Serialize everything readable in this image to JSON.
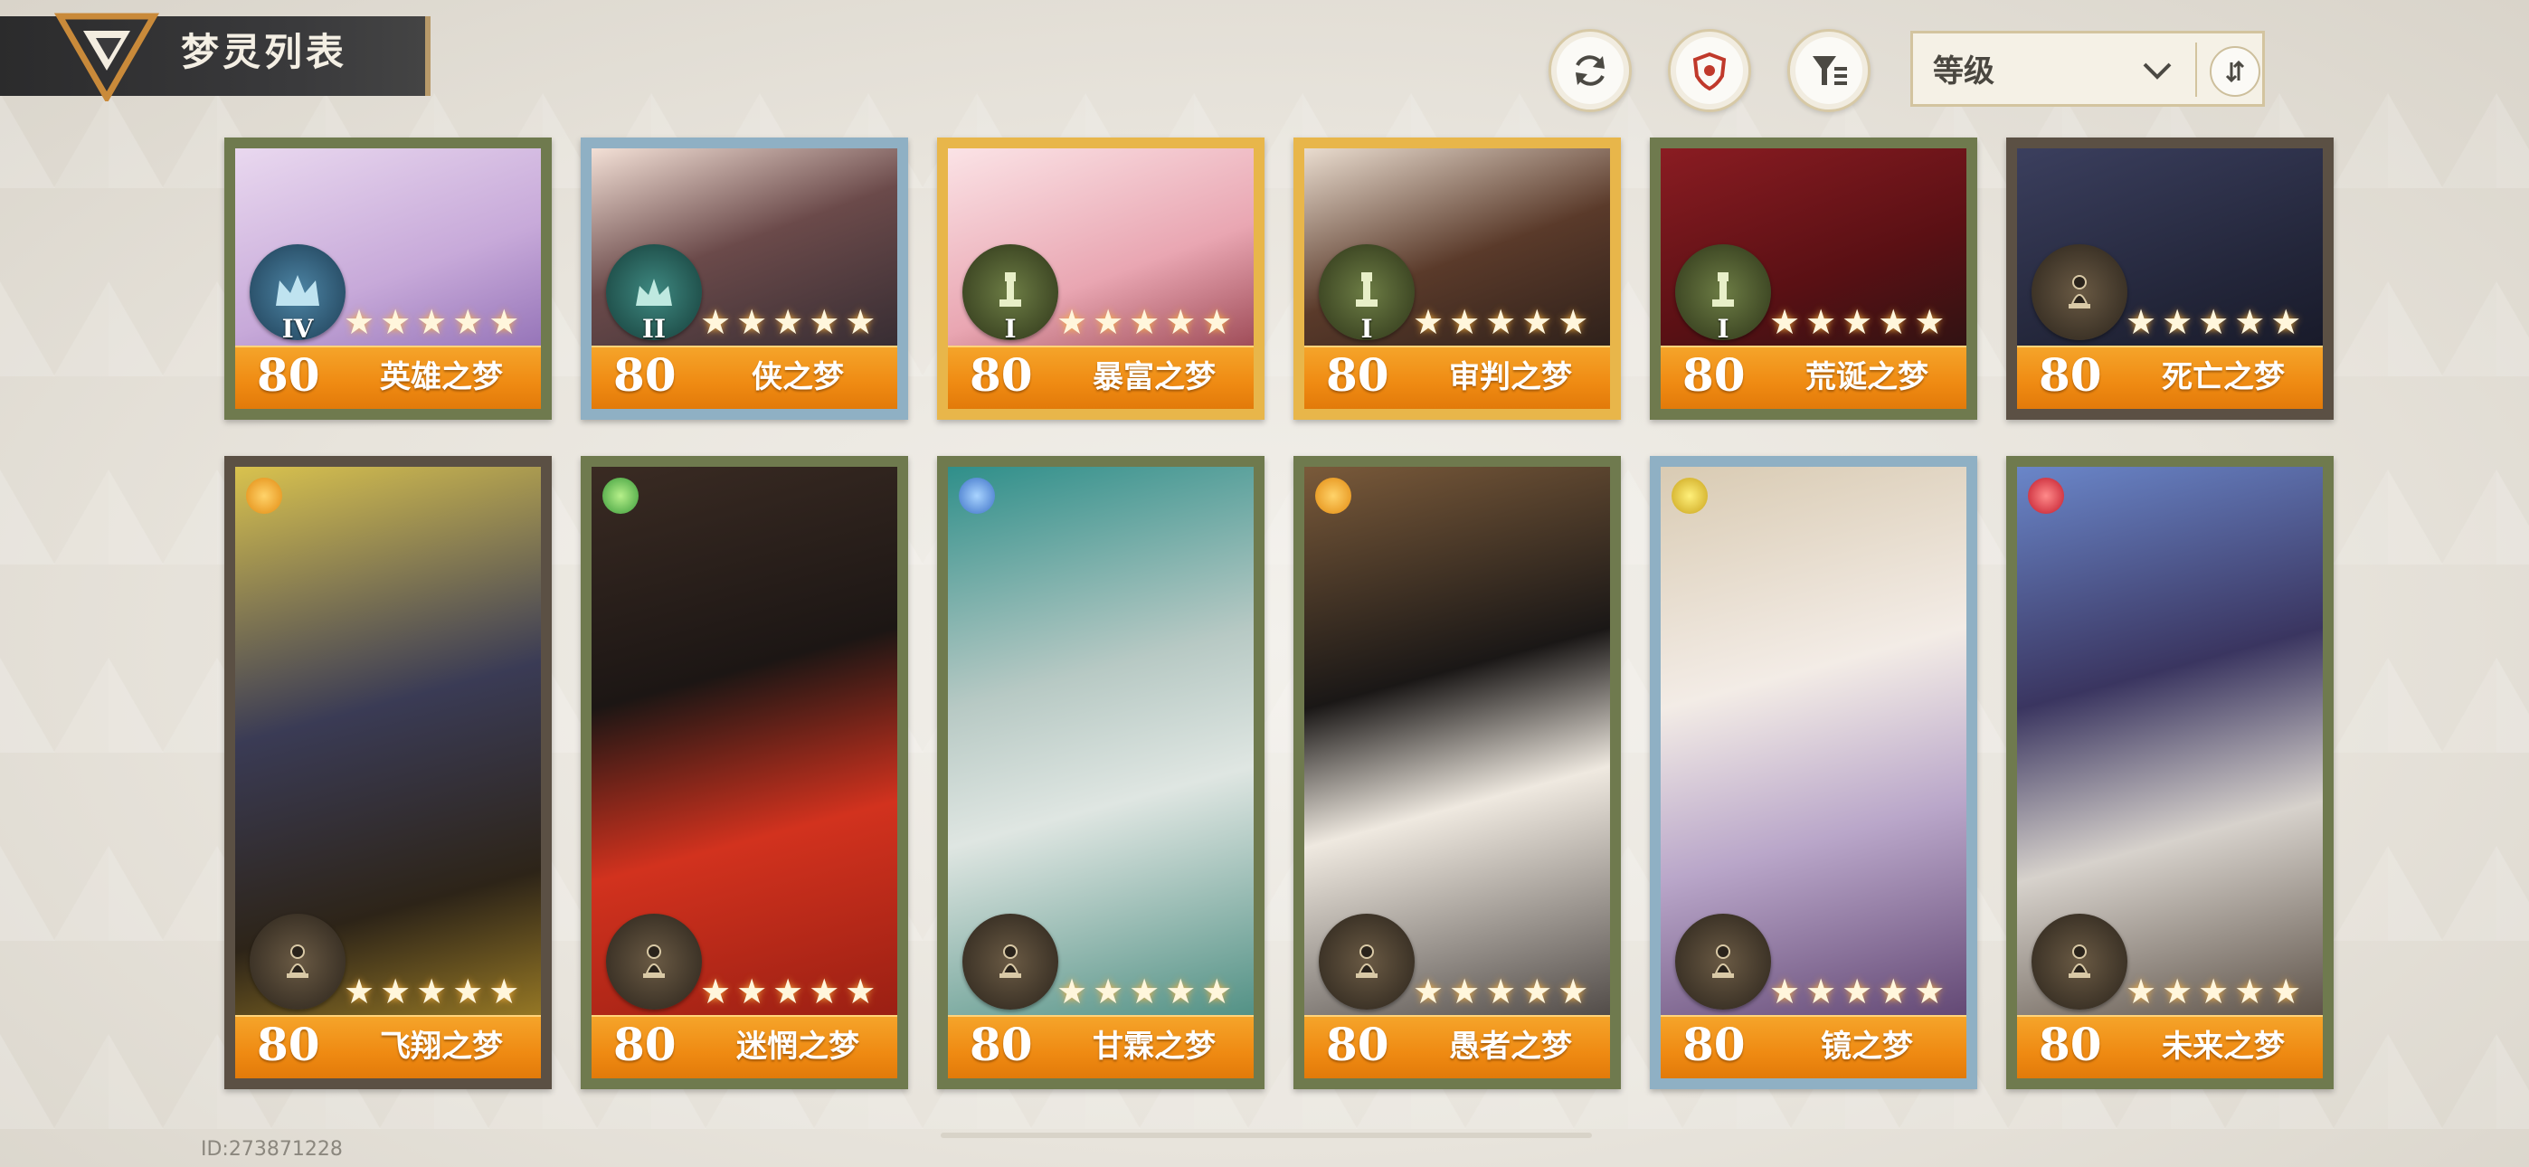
{
  "header": {
    "title": "梦灵列表",
    "sort": {
      "label": "等级"
    }
  },
  "colors": {
    "accent_orange": "#ef8a12",
    "frame_green": "#6f7a4e",
    "frame_blue": "#8fb0c4",
    "frame_gold": "#e8b64a"
  },
  "icons": {
    "refresh": "refresh-icon",
    "shield": "shield-icon",
    "filter": "filter-icon",
    "chevron": "chevron-down-icon",
    "sort_order": "sort-order-icon"
  },
  "cards_top": [
    {
      "level": "80",
      "name": "英雄之梦",
      "rank": "IV",
      "stars": "★★★★★",
      "frame": "green"
    },
    {
      "level": "80",
      "name": "侠之梦",
      "rank": "II",
      "stars": "★★★★★",
      "frame": "blue"
    },
    {
      "level": "80",
      "name": "暴富之梦",
      "rank": "I",
      "stars": "★★★★★",
      "frame": "gold"
    },
    {
      "level": "80",
      "name": "审判之梦",
      "rank": "I",
      "stars": "★★★★★",
      "frame": "gold"
    },
    {
      "level": "80",
      "name": "荒诞之梦",
      "rank": "I",
      "stars": "★★★★★",
      "frame": "green"
    },
    {
      "level": "80",
      "name": "死亡之梦",
      "rank": "",
      "stars": "★★★★★",
      "frame": "dark"
    }
  ],
  "cards_bottom": [
    {
      "level": "80",
      "name": "飞翔之梦",
      "stars": "★★★★★",
      "frame": "dark"
    },
    {
      "level": "80",
      "name": "迷惘之梦",
      "stars": "★★★★★",
      "frame": "green"
    },
    {
      "level": "80",
      "name": "甘霖之梦",
      "stars": "★★★★★",
      "frame": "green"
    },
    {
      "level": "80",
      "name": "愚者之梦",
      "stars": "★★★★★",
      "frame": "green"
    },
    {
      "level": "80",
      "name": "镜之梦",
      "stars": "★★★★★",
      "frame": "blue"
    },
    {
      "level": "80",
      "name": "未来之梦",
      "stars": "★★★★★",
      "frame": "green"
    }
  ],
  "footer": {
    "id_text": "ID:273871228"
  }
}
